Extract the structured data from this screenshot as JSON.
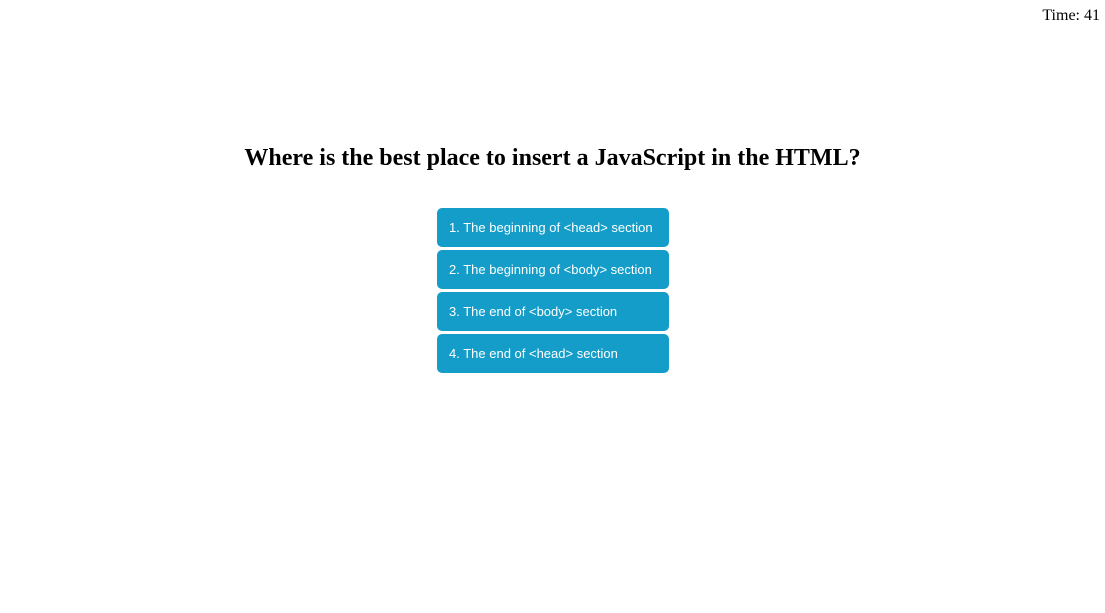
{
  "timer": {
    "label": "Time:",
    "value": "41"
  },
  "question": {
    "text": "Where is the best place to insert a JavaScript in the HTML?"
  },
  "answers": [
    {
      "label": "1. The beginning of <head> section"
    },
    {
      "label": "2. The beginning of <body> section"
    },
    {
      "label": "3. The end of <body> section"
    },
    {
      "label": "4. The end of <head> section"
    }
  ],
  "colors": {
    "answer_background": "#139dc8",
    "answer_text": "#ffffff",
    "page_background": "#ffffff"
  }
}
